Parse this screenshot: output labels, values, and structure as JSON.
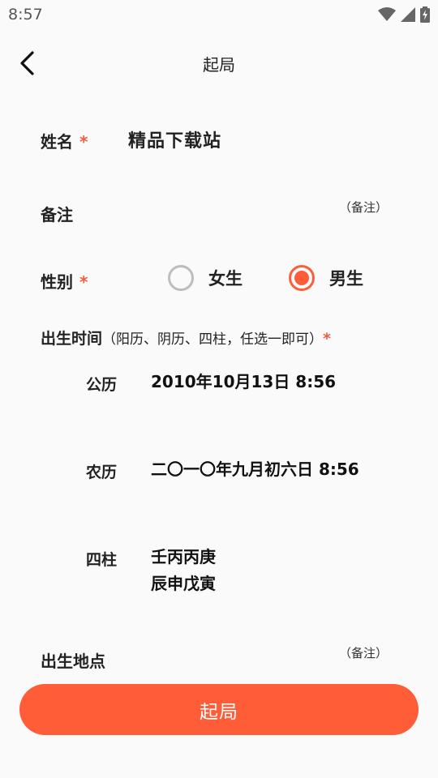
{
  "status_bar": {
    "time": "8:57"
  },
  "app_bar": {
    "title": "起局"
  },
  "form": {
    "name": {
      "label": "姓名",
      "required": "*",
      "value": "精品下载站"
    },
    "note": {
      "label": "备注",
      "hint": "（备注）"
    },
    "gender": {
      "label": "性别",
      "required": "*",
      "options": [
        {
          "label": "女生",
          "checked": false
        },
        {
          "label": "男生",
          "checked": true
        }
      ]
    },
    "birth_time": {
      "title": "出生时间",
      "hint": "（阳历、阴历、四柱，任选一即可）",
      "required": "*",
      "solar": {
        "label": "公历",
        "value": "2010年10月13日 8:56"
      },
      "lunar": {
        "label": "农历",
        "value": "二〇一〇年九月初六日 8:56"
      },
      "pillars": {
        "label": "四柱",
        "line1": "壬丙丙庚",
        "line2": "辰申戊寅"
      }
    },
    "birth_place": {
      "label": "出生地点",
      "hint": "（备注）"
    }
  },
  "submit_label": "起局",
  "colors": {
    "accent": "#ff5c38",
    "background": "#fafafa"
  }
}
